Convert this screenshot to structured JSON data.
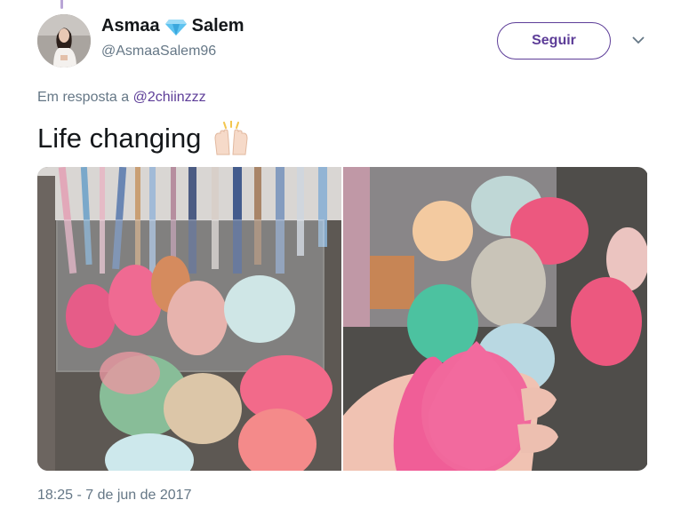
{
  "tweet": {
    "author": {
      "name_first": "Asmaa",
      "name_last": "Salem",
      "badge_icon": "gem-icon",
      "handle": "@AsmaaSalem96",
      "avatar": "profile-photo"
    },
    "follow_label": "Seguir",
    "menu_icon": "chevron-down-icon",
    "reply": {
      "prefix": "Em resposta a",
      "mention": "@2chiinzzz"
    },
    "text": "Life changing",
    "emoji": "raised-hands-icon",
    "media": [
      {
        "name": "photo-1",
        "subject": "makeup-sponges-in-organizer"
      },
      {
        "name": "photo-2",
        "subject": "makeup-sponges-held-in-hand"
      }
    ],
    "timestamp": "18:25 - 7 de jun de 2017"
  },
  "colors": {
    "accent": "#5d3d98",
    "secondary_text": "#657786",
    "primary_text": "#14171a"
  }
}
